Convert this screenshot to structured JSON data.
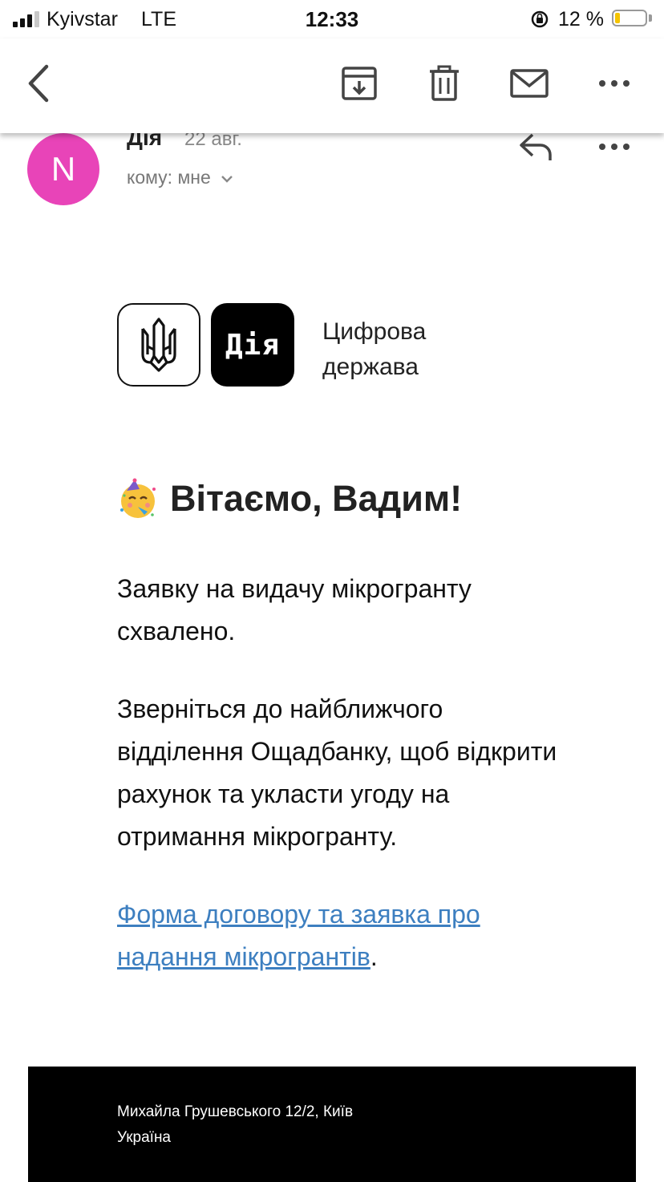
{
  "status_bar": {
    "carrier": "Kyivstar",
    "network": "LTE",
    "time": "12:33",
    "battery_percent": "12 %",
    "battery_level": 0.12
  },
  "toolbar": {
    "back_icon": "chevron-left-icon",
    "archive_icon": "archive-icon",
    "delete_icon": "trash-icon",
    "mark_icon": "envelope-icon",
    "more_icon": "more-horizontal-icon"
  },
  "email_header": {
    "avatar_letter": "N",
    "avatar_color": "#e844b8",
    "sender": "Дія",
    "date": "22 авг.",
    "recipient": "кому: мне"
  },
  "brand": {
    "logo_text": "Дія",
    "tagline_line1": "Цифрова",
    "tagline_line2": "держава"
  },
  "body": {
    "greeting": "Вітаємо, Вадим!",
    "paragraph1": "Заявку на видачу мікрогранту схвалено.",
    "paragraph2": "Зверніться до найближчого відділення Ощадбанку, щоб відкрити рахунок та укласти угоду на отримання мікрогранту.",
    "link_text": "Форма договору та заявка про надання мікрогрантів",
    "link_suffix": ".",
    "link_color": "#3d7fc0"
  },
  "footer": {
    "address_line1": "Михайла Грушевського 12/2, Київ",
    "address_line2": "Україна"
  }
}
